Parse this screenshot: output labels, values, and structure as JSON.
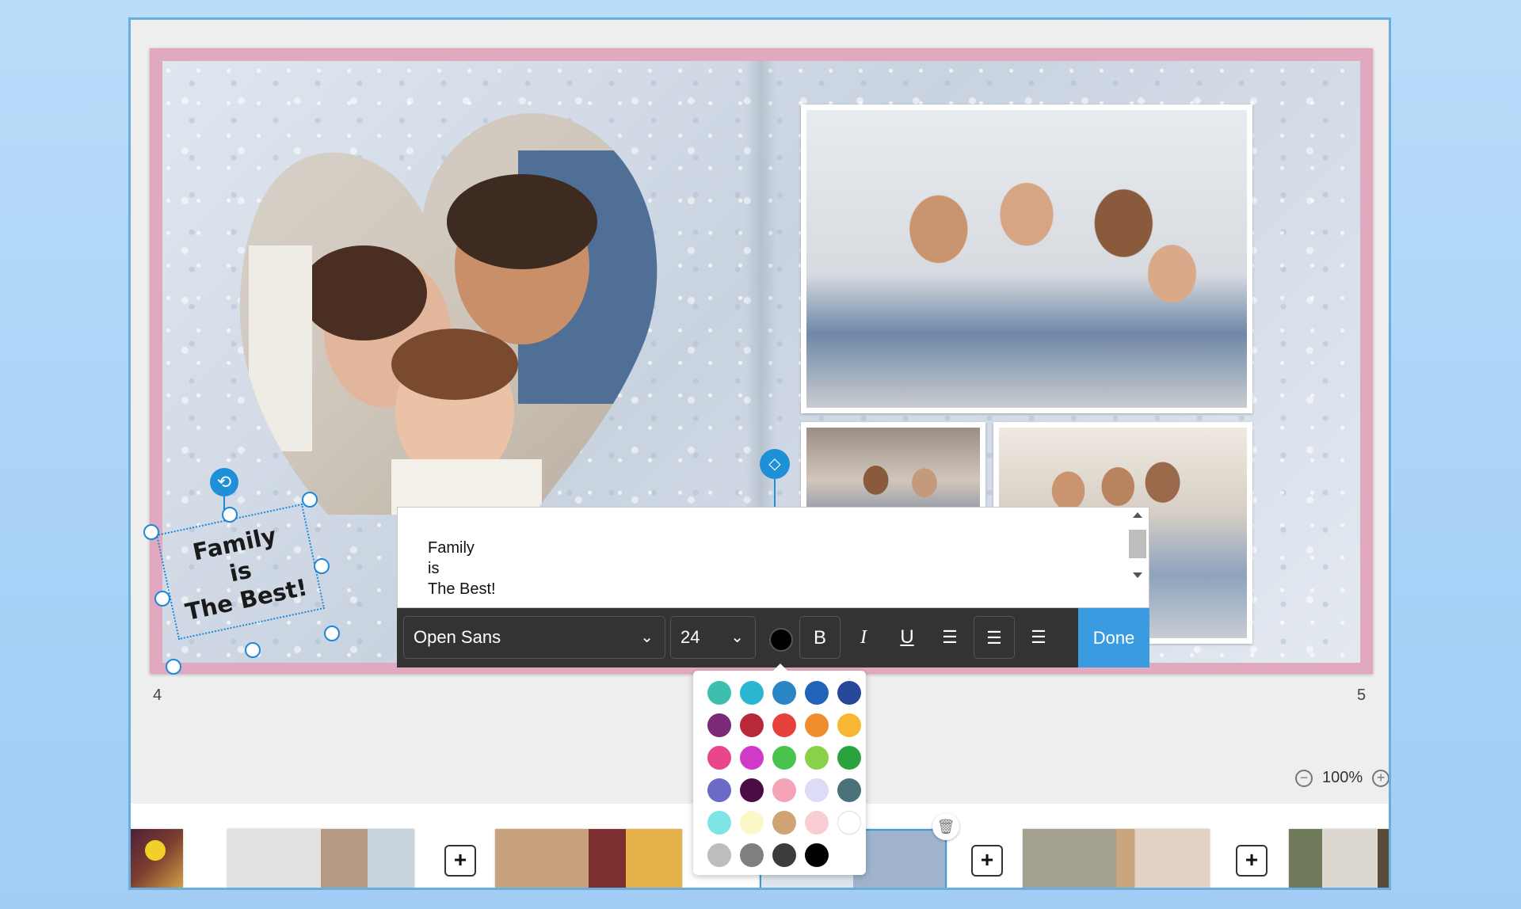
{
  "spread": {
    "left_page_number": "4",
    "right_page_number": "5"
  },
  "page_text": {
    "lines": [
      "Family",
      "is",
      "The Best!"
    ]
  },
  "editor": {
    "lines": [
      "Family",
      "is",
      "The Best!"
    ],
    "font_family": "Open Sans",
    "font_size": "24",
    "bold_label": "B",
    "italic_label": "I",
    "underline_label": "U",
    "done_label": "Done",
    "current_color": "#000000"
  },
  "palette": {
    "colors": [
      "#3dbfb0",
      "#2bb5d0",
      "#2a86c4",
      "#2163b8",
      "#26479a",
      "#7b2a79",
      "#b8283a",
      "#e8403c",
      "#ef8d2c",
      "#f7b731",
      "#e8458d",
      "#cf3ac9",
      "#49c24e",
      "#8ad14a",
      "#2ba23c",
      "#6b6bc7",
      "#4a0b47",
      "#f5a3b6",
      "#dcdcf7",
      "#4a7278",
      "#7fe4e6",
      "#fbf7c8",
      "#cfa472",
      "#f9cdd2",
      "#ffffff",
      "#bdbdbd",
      "#7f7f7f",
      "#3c3c3c",
      "#000000"
    ]
  },
  "zoom": {
    "value": "100%"
  },
  "filmstrip": {
    "add_label": "+"
  },
  "colors": {
    "accent": "#3b9be0",
    "selection": "#1e88d8",
    "toolbar_bg": "#333333"
  }
}
